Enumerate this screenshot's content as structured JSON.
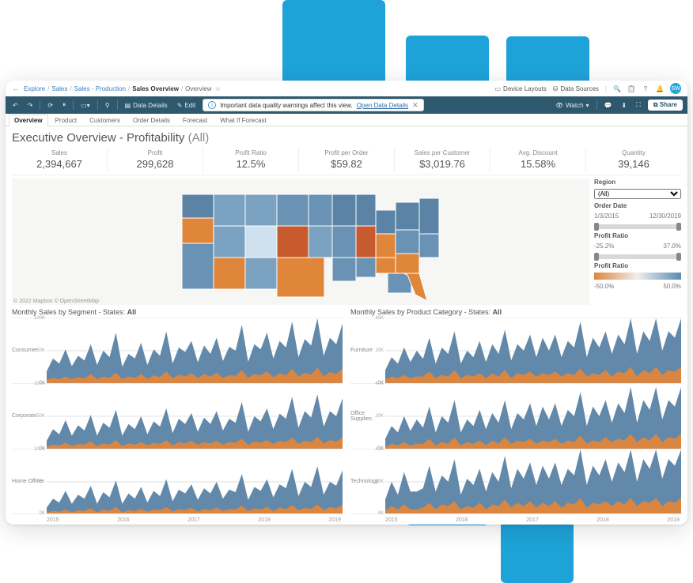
{
  "breadcrumbs": {
    "back_icon": "←",
    "items": [
      "Explore",
      "Sales",
      "Sales - Production",
      "Sales Overview"
    ],
    "leaf": "Overview"
  },
  "topbar_right": {
    "device_layouts": "Device Layouts",
    "data_sources": "Data Sources",
    "avatar_initials": "SW"
  },
  "toolbar": {
    "data_details": "Data Details",
    "edit": "Edit",
    "watch": "Watch",
    "share": "Share"
  },
  "banner": {
    "text": "Important data quality warnings affect this view.",
    "link": "Open Data Details"
  },
  "tabs": [
    "Overview",
    "Product",
    "Customers",
    "Order Details",
    "Forecast",
    "What If Forecast"
  ],
  "activeTab": 0,
  "title": {
    "main": "Executive Overview - Profitability",
    "suffix": "(All)"
  },
  "kpis": [
    {
      "label": "Sales",
      "value": "2,394,667"
    },
    {
      "label": "Profit",
      "value": "299,628"
    },
    {
      "label": "Profit Ratio",
      "value": "12.5%"
    },
    {
      "label": "Profit per Order",
      "value": "$59.82"
    },
    {
      "label": "Sales per Customer",
      "value": "$3,019.76"
    },
    {
      "label": "Avg. Discount",
      "value": "15.58%"
    },
    {
      "label": "Quantity",
      "value": "39,146"
    }
  ],
  "filters": {
    "region_label": "Region",
    "region_value": "(All)",
    "orderdate_label": "Order Date",
    "orderdate_from": "1/3/2015",
    "orderdate_to": "12/30/2019",
    "profit_ratio_label": "Profit Ratio",
    "profit_ratio_min": "-25.2%",
    "profit_ratio_max": "37.0%",
    "profit_ratio2_label": "Profit Ratio",
    "profit_ratio2_min": "-50.0%",
    "profit_ratio2_max": "50.0%"
  },
  "attribution": "© 2022 Mapbox  © OpenStreetMap",
  "chart_titles": {
    "left_prefix": "Monthly Sales by Segment - States: ",
    "left_suffix": "All",
    "right_prefix": "Monthly Sales by Product Category - States: ",
    "right_suffix": "All"
  },
  "chart_data": [
    {
      "type": "area",
      "title": "Monthly Sales by Segment - States: All",
      "xlabel": "",
      "ylabel": "",
      "ylim": [
        0,
        100
      ],
      "x_years": [
        "2015",
        "2016",
        "2017",
        "2018",
        "2019"
      ],
      "y_ticks": [
        "0K",
        "50K",
        "100K"
      ],
      "rows": [
        "Consumer",
        "Corporate",
        "Home Office"
      ],
      "series": [
        {
          "row": "Consumer",
          "name": "total",
          "values": [
            18,
            38,
            30,
            52,
            26,
            42,
            35,
            60,
            28,
            50,
            40,
            78,
            25,
            45,
            38,
            62,
            28,
            52,
            42,
            80,
            30,
            55,
            48,
            65,
            32,
            58,
            45,
            70,
            34,
            56,
            50,
            90,
            33,
            60,
            52,
            78,
            38,
            65,
            55,
            95,
            40,
            68,
            58,
            100,
            42,
            70,
            60,
            92
          ]
        },
        {
          "row": "Consumer",
          "name": "secondary",
          "values": [
            5,
            8,
            6,
            10,
            6,
            9,
            7,
            14,
            6,
            10,
            8,
            16,
            6,
            10,
            8,
            14,
            6,
            12,
            9,
            18,
            7,
            13,
            10,
            15,
            8,
            14,
            10,
            16,
            8,
            12,
            11,
            20,
            8,
            14,
            12,
            18,
            9,
            15,
            12,
            22,
            10,
            16,
            13,
            24,
            10,
            17,
            14,
            22
          ]
        },
        {
          "row": "Corporate",
          "name": "total",
          "values": [
            12,
            30,
            22,
            44,
            20,
            36,
            28,
            52,
            20,
            40,
            32,
            60,
            20,
            38,
            30,
            50,
            22,
            42,
            34,
            62,
            24,
            46,
            38,
            55,
            26,
            48,
            38,
            58,
            28,
            46,
            40,
            72,
            26,
            50,
            42,
            62,
            30,
            54,
            46,
            80,
            32,
            58,
            48,
            84,
            34,
            58,
            50,
            78
          ]
        },
        {
          "row": "Corporate",
          "name": "secondary",
          "values": [
            3,
            6,
            5,
            9,
            4,
            7,
            6,
            11,
            4,
            8,
            6,
            13,
            4,
            8,
            6,
            10,
            5,
            9,
            7,
            13,
            5,
            10,
            8,
            12,
            6,
            10,
            8,
            12,
            6,
            10,
            9,
            15,
            6,
            11,
            9,
            13,
            7,
            12,
            10,
            17,
            7,
            12,
            10,
            18,
            8,
            13,
            11,
            17
          ]
        },
        {
          "row": "Home Office",
          "name": "total",
          "values": [
            10,
            24,
            18,
            36,
            16,
            30,
            24,
            44,
            16,
            34,
            26,
            52,
            16,
            32,
            24,
            42,
            18,
            36,
            28,
            54,
            20,
            38,
            32,
            46,
            22,
            40,
            32,
            50,
            24,
            38,
            34,
            62,
            22,
            42,
            36,
            54,
            26,
            46,
            40,
            70,
            28,
            50,
            42,
            74,
            30,
            50,
            44,
            68
          ]
        },
        {
          "row": "Home Office",
          "name": "secondary",
          "values": [
            2,
            5,
            4,
            7,
            3,
            6,
            5,
            9,
            3,
            7,
            5,
            11,
            3,
            6,
            5,
            8,
            4,
            7,
            6,
            11,
            4,
            8,
            6,
            10,
            4,
            8,
            6,
            10,
            5,
            8,
            7,
            13,
            5,
            9,
            7,
            11,
            5,
            10,
            8,
            14,
            6,
            10,
            8,
            15,
            6,
            11,
            9,
            14
          ]
        }
      ]
    },
    {
      "type": "area",
      "title": "Monthly Sales by Product Category - States: All",
      "xlabel": "",
      "ylabel": "",
      "ylim": [
        0,
        40
      ],
      "x_years": [
        "2015",
        "2016",
        "2017",
        "2018",
        "2019"
      ],
      "y_ticks": [
        "0K",
        "20K",
        "40K"
      ],
      "rows": [
        "Furniture",
        "Office Supplies",
        "Technology"
      ],
      "series": [
        {
          "row": "Furniture",
          "name": "total",
          "values": [
            8,
            16,
            12,
            22,
            13,
            20,
            15,
            28,
            12,
            22,
            18,
            32,
            12,
            20,
            16,
            26,
            13,
            24,
            18,
            33,
            14,
            24,
            20,
            30,
            16,
            28,
            20,
            30,
            16,
            26,
            22,
            38,
            16,
            28,
            22,
            32,
            18,
            30,
            24,
            40,
            18,
            32,
            26,
            40,
            20,
            32,
            28,
            40
          ]
        },
        {
          "row": "Furniture",
          "name": "secondary",
          "values": [
            2,
            4,
            3,
            5,
            3,
            4,
            4,
            7,
            3,
            5,
            4,
            8,
            3,
            5,
            4,
            6,
            3,
            6,
            4,
            8,
            3,
            6,
            5,
            7,
            4,
            6,
            5,
            7,
            4,
            6,
            5,
            9,
            4,
            6,
            5,
            8,
            4,
            7,
            6,
            10,
            4,
            8,
            6,
            10,
            5,
            8,
            7,
            10
          ]
        },
        {
          "row": "Office Supplies",
          "name": "total",
          "values": [
            6,
            14,
            10,
            20,
            11,
            18,
            13,
            26,
            10,
            20,
            16,
            30,
            10,
            18,
            14,
            24,
            12,
            22,
            16,
            30,
            12,
            22,
            18,
            28,
            14,
            26,
            18,
            28,
            14,
            24,
            20,
            35,
            14,
            26,
            20,
            30,
            16,
            28,
            22,
            38,
            16,
            30,
            24,
            38,
            18,
            30,
            26,
            38
          ]
        },
        {
          "row": "Office Supplies",
          "name": "secondary",
          "values": [
            1,
            3,
            2,
            4,
            2,
            3,
            3,
            6,
            2,
            4,
            3,
            7,
            2,
            4,
            3,
            5,
            2,
            5,
            3,
            7,
            3,
            5,
            4,
            6,
            3,
            5,
            4,
            6,
            3,
            5,
            4,
            8,
            3,
            5,
            4,
            7,
            4,
            6,
            5,
            9,
            4,
            7,
            5,
            9,
            4,
            7,
            6,
            9
          ]
        },
        {
          "row": "Technology",
          "name": "total",
          "values": [
            9,
            20,
            12,
            26,
            14,
            14,
            16,
            30,
            14,
            24,
            20,
            34,
            12,
            22,
            18,
            28,
            14,
            26,
            20,
            36,
            16,
            28,
            22,
            32,
            18,
            30,
            22,
            32,
            18,
            28,
            24,
            40,
            18,
            30,
            24,
            34,
            20,
            32,
            26,
            40,
            20,
            34,
            28,
            40,
            22,
            34,
            30,
            40
          ]
        },
        {
          "row": "Technology",
          "name": "secondary",
          "values": [
            2,
            5,
            3,
            6,
            3,
            3,
            4,
            7,
            3,
            6,
            5,
            8,
            3,
            5,
            4,
            7,
            3,
            6,
            5,
            9,
            4,
            7,
            5,
            8,
            4,
            7,
            5,
            8,
            4,
            7,
            6,
            10,
            4,
            7,
            6,
            8,
            5,
            8,
            6,
            10,
            5,
            8,
            7,
            10,
            5,
            8,
            7,
            10
          ]
        }
      ]
    }
  ]
}
